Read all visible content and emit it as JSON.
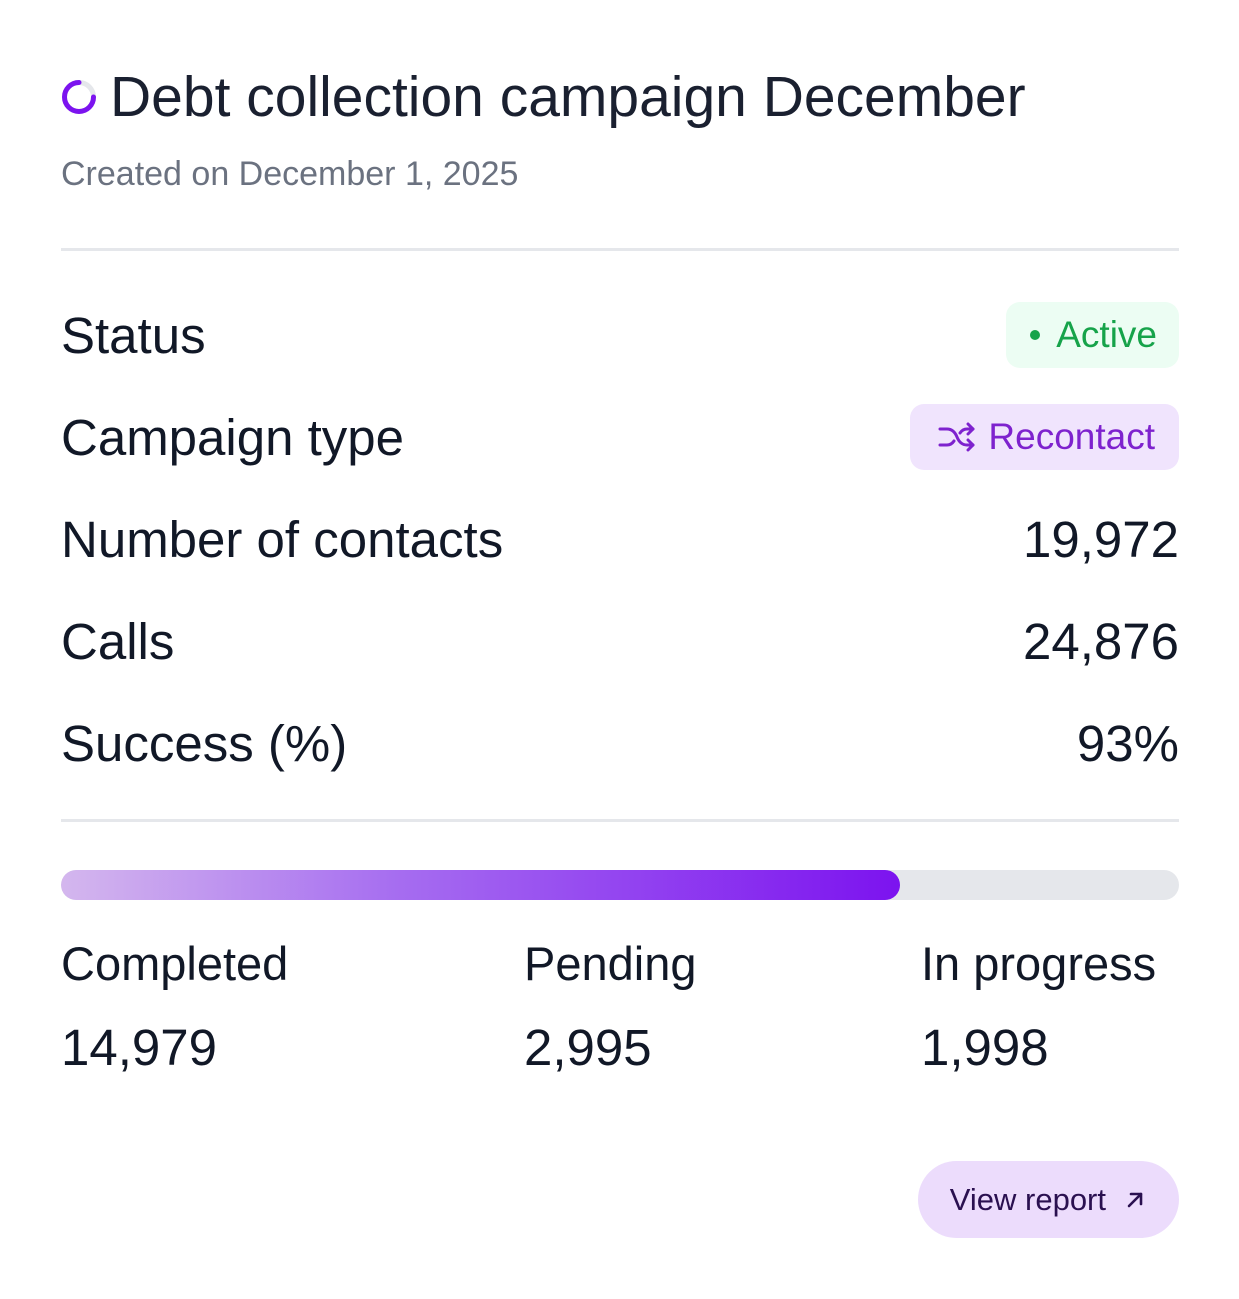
{
  "header": {
    "title": "Debt collection campaign December",
    "subtitle": "Created on December 1, 2025",
    "icon": "spinner-icon",
    "accent_color": "#7c13ef"
  },
  "details": {
    "status": {
      "label": "Status",
      "value": "Active",
      "color": "#16a34a",
      "background": "#ecfdf3"
    },
    "campaign_type": {
      "label": "Campaign type",
      "value": "Recontact",
      "icon": "shuffle-icon",
      "color": "#7e22ce",
      "background": "#f0e4fd"
    },
    "contacts": {
      "label": "Number of contacts",
      "value": "19,972"
    },
    "calls": {
      "label": "Calls",
      "value": "24,876"
    },
    "success": {
      "label": "Success (%)",
      "value": "93%"
    }
  },
  "progress": {
    "completed_fraction": 0.75
  },
  "stats": {
    "completed": {
      "label": "Completed",
      "value": "14,979"
    },
    "pending": {
      "label": "Pending",
      "value": "2,995"
    },
    "in_progress": {
      "label": "In progress",
      "value": "1,998"
    }
  },
  "actions": {
    "view_report_label": "View report",
    "view_report_icon": "arrow-up-right-icon"
  }
}
